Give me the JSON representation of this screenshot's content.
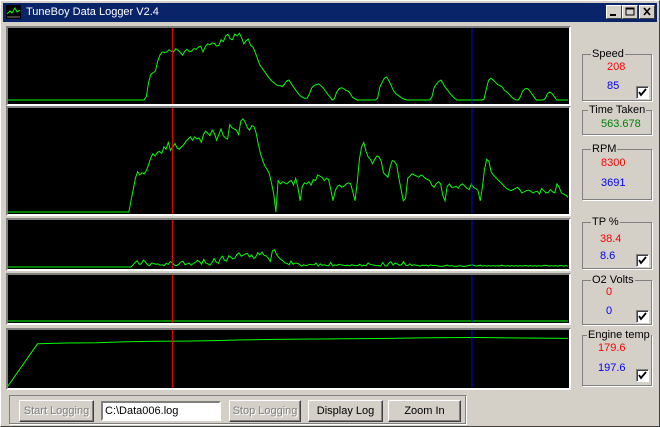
{
  "window": {
    "title": "TuneBoy Data Logger V2.4"
  },
  "colors": {
    "trace": "#00ff00",
    "cursor_a": "#ff0000",
    "cursor_b": "#0000ff",
    "cursor_a_value": "#ff0000",
    "cursor_b_value": "#0000ff",
    "time_value": "#008000"
  },
  "gauges": {
    "speed": {
      "label": "Speed",
      "value_a": "208",
      "value_b": "85",
      "checked": true
    },
    "time": {
      "label": "Time Taken",
      "value": "563.678"
    },
    "rpm": {
      "label": "RPM",
      "value_a": "8300",
      "value_b": "3691"
    },
    "tp": {
      "label": "TP %",
      "value_a": "38.4",
      "value_b": "8.6",
      "checked": true
    },
    "o2": {
      "label": "O2 Volts",
      "value_a": "0",
      "value_b": "0",
      "checked": true
    },
    "engine_temp": {
      "label": "Engine temp",
      "value_a": "179.6",
      "value_b": "197.6",
      "checked": true
    }
  },
  "controls": {
    "start_logging": "Start Logging",
    "file_path": "C:\\Data006.log",
    "stop_logging": "Stop Logging",
    "display_log": "Display Log",
    "zoom_in": "Zoom In"
  },
  "chart_data": [
    {
      "type": "line",
      "series": [
        {
          "name": "Speed",
          "values": [
            0,
            0,
            0,
            0,
            0,
            0,
            0,
            0,
            0,
            0,
            0,
            0,
            0,
            0,
            0,
            0,
            0,
            0,
            0,
            0,
            0,
            0,
            0,
            0,
            0,
            0,
            0,
            0,
            0,
            0,
            0,
            0,
            0,
            0,
            0,
            0,
            0,
            0,
            0,
            0,
            0,
            0,
            0,
            0,
            0,
            0,
            0,
            0,
            0,
            0,
            0,
            0,
            0,
            0,
            0,
            0,
            0,
            0,
            0,
            0,
            0,
            10,
            55,
            80,
            85,
            90,
            120,
            140,
            150,
            148,
            150,
            156,
            152,
            150,
            160,
            155,
            148,
            140,
            152,
            158,
            150,
            153,
            160,
            158,
            165,
            168,
            150,
            166,
            175,
            172,
            178,
            176,
            168,
            170,
            188,
            182,
            200,
            205,
            190,
            188,
            205,
            200,
            208,
            195,
            175,
            185,
            190,
            170,
            165,
            150,
            130,
            110,
            100,
            90,
            80,
            70,
            62,
            55,
            50,
            45,
            45,
            42,
            50,
            60,
            62,
            50,
            40,
            30,
            20,
            12,
            8,
            5,
            6,
            20,
            38,
            45,
            48,
            50,
            45,
            38,
            28,
            18,
            10,
            0,
            5,
            25,
            35,
            38,
            36,
            30,
            28,
            20,
            8,
            4,
            0,
            0,
            0,
            0,
            0,
            0,
            0,
            0,
            0,
            6,
            40,
            55,
            68,
            72,
            60,
            45,
            30,
            20,
            15,
            10,
            5,
            2,
            0,
            0,
            0,
            0,
            0,
            0,
            0,
            0,
            0,
            0,
            0,
            10,
            40,
            50,
            58,
            62,
            50,
            38,
            30,
            20,
            12,
            5,
            0,
            0,
            0,
            0,
            0,
            0,
            0,
            0,
            0,
            0,
            0,
            0,
            3,
            35,
            62,
            68,
            62,
            55,
            48,
            45,
            40,
            30,
            25,
            18,
            10,
            4,
            0,
            0,
            10,
            28,
            35,
            36,
            30,
            20,
            10,
            0,
            0,
            0,
            0,
            5,
            20,
            25,
            20,
            10,
            0,
            0,
            0,
            0,
            0,
            0
          ]
        }
      ],
      "ylim": [
        0,
        215
      ]
    },
    {
      "type": "line",
      "series": [
        {
          "name": "RPM",
          "values": [
            0,
            0,
            0,
            0,
            0,
            0,
            0,
            0,
            0,
            0,
            0,
            0,
            0,
            0,
            0,
            0,
            0,
            0,
            0,
            0,
            0,
            0,
            0,
            0,
            0,
            0,
            0,
            0,
            0,
            0,
            0,
            0,
            0,
            0,
            0,
            0,
            0,
            0,
            0,
            0,
            0,
            0,
            0,
            0,
            0,
            0,
            0,
            0,
            0,
            0,
            0,
            0,
            0,
            0,
            0,
            0,
            1000,
            2000,
            3000,
            3600,
            3300,
            3500,
            3400,
            3700,
            4200,
            4800,
            5200,
            5000,
            5300,
            5400,
            5200,
            5800,
            5600,
            6200,
            5500,
            5800,
            6100,
            5700,
            5600,
            5800,
            6000,
            6300,
            6500,
            6700,
            6400,
            6700,
            6500,
            6600,
            6200,
            6900,
            7200,
            7000,
            6800,
            7300,
            7000,
            6400,
            6900,
            7400,
            6800,
            6600,
            6500,
            7800,
            7500,
            7400,
            7300,
            6900,
            8100,
            8300,
            8000,
            7500,
            7300,
            7700,
            7600,
            7000,
            6000,
            5200,
            4600,
            4100,
            3800,
            3400,
            2600,
            1600,
            0,
            2800,
            2500,
            2700,
            2600,
            2500,
            2700,
            2800,
            2400,
            3000,
            2200,
            1000,
            2300,
            2600,
            2500,
            2700,
            2400,
            2900,
            2800,
            3300,
            3200,
            3100,
            2800,
            3000,
            2900,
            2000,
            1000,
            1900,
            2300,
            2400,
            2200,
            2300,
            2500,
            2600,
            2500,
            1800,
            1000,
            2600,
            4700,
            5800,
            6200,
            5400,
            4900,
            4700,
            4300,
            4700,
            5000,
            4900,
            4500,
            3500,
            3300,
            3100,
            4000,
            4600,
            4500,
            4200,
            3000,
            2000,
            1000,
            1200,
            3000,
            3200,
            3400,
            3300,
            3200,
            3100,
            3300,
            3200,
            3000,
            2900,
            2800,
            2400,
            2200,
            2500,
            2700,
            2500,
            1500,
            1000,
            2300,
            2500,
            2200,
            2200,
            2300,
            2100,
            2400,
            2500,
            2300,
            2100,
            2000,
            2500,
            2200,
            2100,
            1900,
            1000,
            2200,
            3800,
            4700,
            4500,
            3600,
            3300,
            3100,
            2900,
            2700,
            2500,
            2300,
            2100,
            2000,
            1900,
            2000,
            2100,
            2200,
            2000,
            1700,
            1800,
            1900,
            1950,
            1850,
            1700,
            1800,
            1850,
            1600,
            2100,
            1900,
            1700,
            1750,
            2000,
            1800,
            1700,
            2500,
            2200,
            1700,
            1600,
            1500,
            1300
          ]
        }
      ],
      "ylim": [
        0,
        9000
      ]
    },
    {
      "type": "line",
      "series": [
        {
          "name": "TP %",
          "values": [
            0,
            0,
            0,
            0,
            0,
            0,
            0,
            0,
            0,
            0,
            0,
            0,
            0,
            0,
            0,
            0,
            0,
            0,
            0,
            0,
            0,
            0,
            0,
            0,
            0,
            0,
            0,
            0,
            0,
            0,
            0,
            0,
            0,
            0,
            0,
            0,
            0,
            0,
            0,
            0,
            0,
            0,
            0,
            0,
            0,
            0,
            0,
            0,
            0,
            0,
            0,
            0,
            0,
            0,
            0,
            0,
            0,
            0,
            0,
            0,
            4,
            10,
            14,
            6,
            7,
            15,
            11,
            5,
            3,
            9,
            8,
            6,
            7,
            4,
            5,
            3,
            8,
            6,
            12,
            9,
            4,
            3,
            6,
            11,
            13,
            5,
            7,
            9,
            4,
            8,
            10,
            15,
            12,
            6,
            17,
            9,
            7,
            4,
            10,
            19,
            11,
            8,
            18,
            24,
            15,
            13,
            25,
            22,
            18,
            20,
            28,
            31,
            24,
            26,
            29,
            30,
            22,
            27,
            19,
            22,
            32,
            27,
            33,
            26,
            25,
            20,
            12,
            36,
            38.4,
            28,
            21,
            17,
            14,
            9,
            8,
            5,
            13,
            6,
            9,
            8,
            6,
            2,
            5,
            3,
            4,
            6,
            5,
            5,
            9,
            2,
            7,
            4,
            5,
            3,
            3,
            10,
            2,
            5,
            3,
            6,
            5,
            4,
            3,
            4,
            2,
            5,
            4,
            3,
            3,
            6,
            2,
            4,
            3,
            9,
            6,
            5,
            4,
            3,
            3,
            2,
            10,
            3,
            2,
            9,
            12,
            4,
            9,
            7,
            4,
            5,
            12,
            4,
            3,
            7,
            3,
            5,
            4,
            3,
            2,
            4,
            3,
            4,
            2,
            5,
            3,
            4,
            3,
            2,
            1,
            2,
            3,
            4,
            2,
            3,
            2,
            1,
            2,
            3,
            2,
            1,
            2,
            3,
            4,
            5,
            3,
            2,
            3,
            4,
            2,
            3,
            2,
            3,
            2,
            3,
            2,
            3,
            2,
            4,
            3,
            2,
            3,
            2,
            3,
            2,
            3,
            2,
            3,
            2,
            3,
            3,
            2,
            3,
            2,
            3,
            2,
            3,
            2,
            3,
            4,
            3,
            2,
            3,
            2,
            3,
            2,
            3,
            3,
            2,
            3,
            2
          ]
        }
      ],
      "ylim": [
        0,
        100
      ]
    },
    {
      "type": "line",
      "series": [
        {
          "name": "O2 Volts",
          "values": [
            0,
            0
          ]
        }
      ]
    },
    {
      "type": "line",
      "series": [
        {
          "name": "Engine temp",
          "values": [
            0,
            172,
            175,
            176,
            180,
            182,
            183,
            185,
            188,
            190,
            191,
            192,
            193,
            194,
            196,
            197,
            197.6,
            196,
            195,
            194
          ]
        }
      ],
      "ylim": [
        0,
        220
      ]
    }
  ]
}
